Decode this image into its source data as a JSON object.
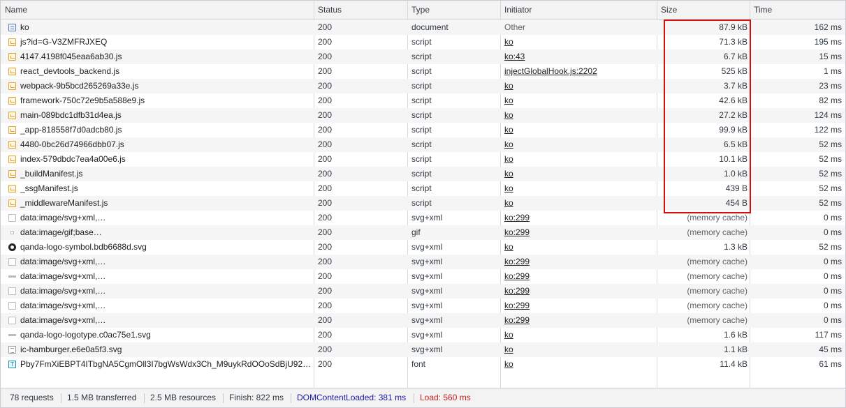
{
  "columns": {
    "name": "Name",
    "status": "Status",
    "type": "Type",
    "initiator": "Initiator",
    "size": "Size",
    "time": "Time"
  },
  "rows": [
    {
      "icon": "document-icon",
      "name": "ko",
      "status": "200",
      "type": "document",
      "initiator": "Other",
      "initiator_link": false,
      "size": "87.9 kB",
      "time": "162 ms"
    },
    {
      "icon": "script-icon",
      "name": "js?id=G-V3ZMFRJXEQ",
      "status": "200",
      "type": "script",
      "initiator": "ko",
      "initiator_link": true,
      "size": "71.3 kB",
      "time": "195 ms"
    },
    {
      "icon": "script-icon",
      "name": "4147.4198f045eaa6ab30.js",
      "status": "200",
      "type": "script",
      "initiator": "ko:43",
      "initiator_link": true,
      "size": "6.7 kB",
      "time": "15 ms"
    },
    {
      "icon": "script-icon",
      "name": "react_devtools_backend.js",
      "status": "200",
      "type": "script",
      "initiator": "injectGlobalHook.js:2202",
      "initiator_link": true,
      "size": "525 kB",
      "time": "1 ms"
    },
    {
      "icon": "script-icon",
      "name": "webpack-9b5bcd265269a33e.js",
      "status": "200",
      "type": "script",
      "initiator": "ko",
      "initiator_link": true,
      "size": "3.7 kB",
      "time": "23 ms"
    },
    {
      "icon": "script-icon",
      "name": "framework-750c72e9b5a588e9.js",
      "status": "200",
      "type": "script",
      "initiator": "ko",
      "initiator_link": true,
      "size": "42.6 kB",
      "time": "82 ms"
    },
    {
      "icon": "script-icon",
      "name": "main-089bdc1dfb31d4ea.js",
      "status": "200",
      "type": "script",
      "initiator": "ko",
      "initiator_link": true,
      "size": "27.2 kB",
      "time": "124 ms"
    },
    {
      "icon": "script-icon",
      "name": "_app-818558f7d0adcb80.js",
      "status": "200",
      "type": "script",
      "initiator": "ko",
      "initiator_link": true,
      "size": "99.9 kB",
      "time": "122 ms"
    },
    {
      "icon": "script-icon",
      "name": "4480-0bc26d74966dbb07.js",
      "status": "200",
      "type": "script",
      "initiator": "ko",
      "initiator_link": true,
      "size": "6.5 kB",
      "time": "52 ms"
    },
    {
      "icon": "script-icon",
      "name": "index-579dbdc7ea4a00e6.js",
      "status": "200",
      "type": "script",
      "initiator": "ko",
      "initiator_link": true,
      "size": "10.1 kB",
      "time": "52 ms"
    },
    {
      "icon": "script-icon",
      "name": "_buildManifest.js",
      "status": "200",
      "type": "script",
      "initiator": "ko",
      "initiator_link": true,
      "size": "1.0 kB",
      "time": "52 ms"
    },
    {
      "icon": "script-icon",
      "name": "_ssgManifest.js",
      "status": "200",
      "type": "script",
      "initiator": "ko",
      "initiator_link": true,
      "size": "439 B",
      "time": "52 ms"
    },
    {
      "icon": "script-icon",
      "name": "_middlewareManifest.js",
      "status": "200",
      "type": "script",
      "initiator": "ko",
      "initiator_link": true,
      "size": "454 B",
      "time": "52 ms"
    },
    {
      "icon": "image-icon",
      "name": "data:image/svg+xml,…",
      "status": "200",
      "type": "svg+xml",
      "initiator": "ko:299",
      "initiator_link": true,
      "size": "(memory cache)",
      "time": "0 ms",
      "muted": true
    },
    {
      "icon": "gif-icon",
      "name": "data:image/gif;base…",
      "status": "200",
      "type": "gif",
      "initiator": "ko:299",
      "initiator_link": true,
      "size": "(memory cache)",
      "time": "0 ms",
      "muted": true
    },
    {
      "icon": "logo-symbol-icon",
      "name": "qanda-logo-symbol.bdb6688d.svg",
      "status": "200",
      "type": "svg+xml",
      "initiator": "ko",
      "initiator_link": true,
      "size": "1.3 kB",
      "time": "52 ms"
    },
    {
      "icon": "image-icon",
      "name": "data:image/svg+xml,…",
      "status": "200",
      "type": "svg+xml",
      "initiator": "ko:299",
      "initiator_link": true,
      "size": "(memory cache)",
      "time": "0 ms",
      "muted": true
    },
    {
      "icon": "dash-icon",
      "name": "data:image/svg+xml,…",
      "status": "200",
      "type": "svg+xml",
      "initiator": "ko:299",
      "initiator_link": true,
      "size": "(memory cache)",
      "time": "0 ms",
      "muted": true
    },
    {
      "icon": "image-icon",
      "name": "data:image/svg+xml,…",
      "status": "200",
      "type": "svg+xml",
      "initiator": "ko:299",
      "initiator_link": true,
      "size": "(memory cache)",
      "time": "0 ms",
      "muted": true
    },
    {
      "icon": "image-icon",
      "name": "data:image/svg+xml,…",
      "status": "200",
      "type": "svg+xml",
      "initiator": "ko:299",
      "initiator_link": true,
      "size": "(memory cache)",
      "time": "0 ms",
      "muted": true
    },
    {
      "icon": "image-icon",
      "name": "data:image/svg+xml,…",
      "status": "200",
      "type": "svg+xml",
      "initiator": "ko:299",
      "initiator_link": true,
      "size": "(memory cache)",
      "time": "0 ms",
      "muted": true
    },
    {
      "icon": "dash-icon",
      "name": "qanda-logo-logotype.c0ac75e1.svg",
      "status": "200",
      "type": "svg+xml",
      "initiator": "ko",
      "initiator_link": true,
      "size": "1.6 kB",
      "time": "117 ms"
    },
    {
      "icon": "hamburger-icon",
      "name": "ic-hamburger.e6e0a5f3.svg",
      "status": "200",
      "type": "svg+xml",
      "initiator": "ko",
      "initiator_link": true,
      "size": "1.1 kB",
      "time": "45 ms"
    },
    {
      "icon": "font-icon",
      "name": "Pby7FmXiEBPT4ITbgNA5CgmOll3I7bgWsWdx3Ch_M9uykRdOOoSdBjU92…",
      "status": "200",
      "type": "font",
      "initiator": "ko",
      "initiator_link": true,
      "size": "11.4 kB",
      "time": "61 ms"
    }
  ],
  "footer": {
    "requests": "78 requests",
    "transferred": "1.5 MB transferred",
    "resources": "2.5 MB resources",
    "finish": "Finish: 822 ms",
    "dom_content_loaded": "DOMContentLoaded: 381 ms",
    "load": "Load: 560 ms"
  },
  "colors": {
    "highlight_box": "#d50f0f",
    "dom_content_loaded": "#1a1aa6",
    "load": "#c5221f"
  }
}
